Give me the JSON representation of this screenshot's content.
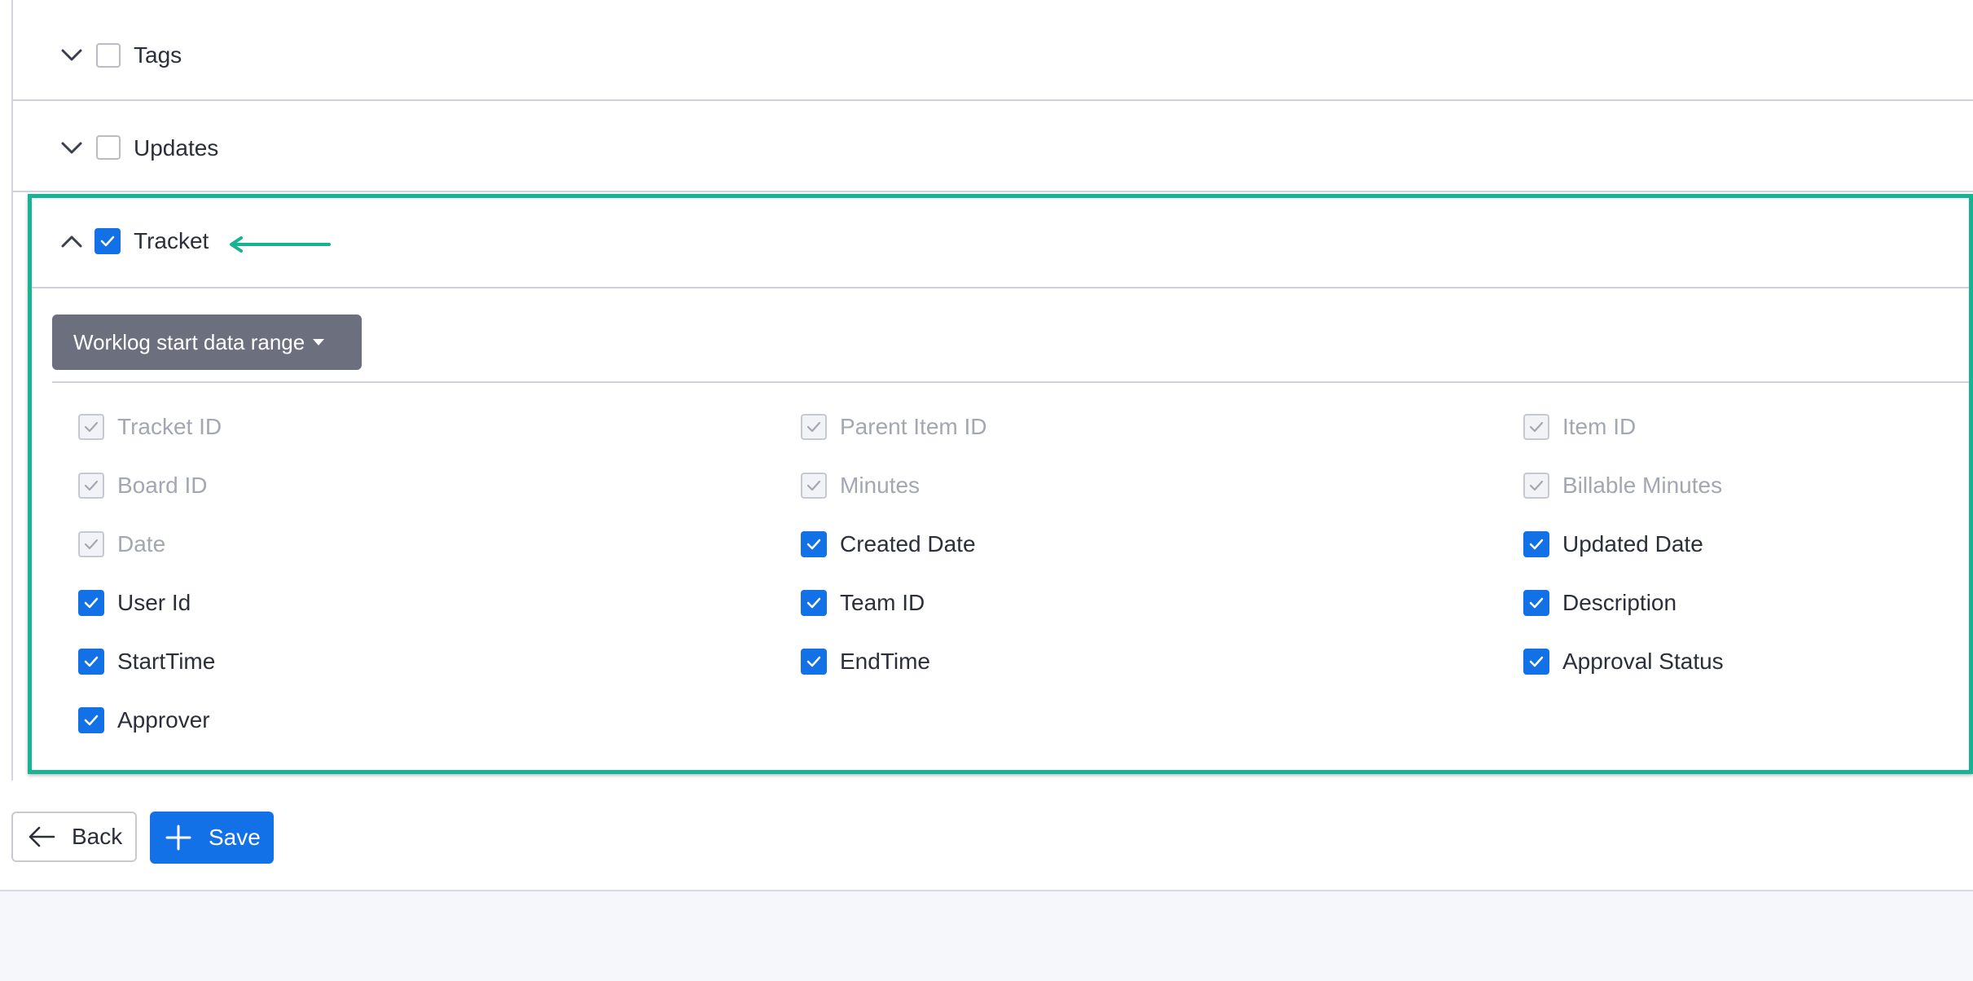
{
  "sections": [
    {
      "label": "Tags",
      "checked": false,
      "expanded": false
    },
    {
      "label": "Updates",
      "checked": false,
      "expanded": false
    },
    {
      "label": "Tracket",
      "checked": true,
      "expanded": true
    }
  ],
  "tracket": {
    "range_button": "Worklog start data range",
    "fields": [
      {
        "label": "Tracket ID",
        "checked": true,
        "disabled": true
      },
      {
        "label": "Parent Item ID",
        "checked": true,
        "disabled": true
      },
      {
        "label": "Item ID",
        "checked": true,
        "disabled": true
      },
      {
        "label": "Board ID",
        "checked": true,
        "disabled": true
      },
      {
        "label": "Minutes",
        "checked": true,
        "disabled": true
      },
      {
        "label": "Billable Minutes",
        "checked": true,
        "disabled": true
      },
      {
        "label": "Date",
        "checked": true,
        "disabled": true
      },
      {
        "label": "Created Date",
        "checked": true,
        "disabled": false
      },
      {
        "label": "Updated Date",
        "checked": true,
        "disabled": false
      },
      {
        "label": "User Id",
        "checked": true,
        "disabled": false
      },
      {
        "label": "Team ID",
        "checked": true,
        "disabled": false
      },
      {
        "label": "Description",
        "checked": true,
        "disabled": false
      },
      {
        "label": "StartTime",
        "checked": true,
        "disabled": false
      },
      {
        "label": "EndTime",
        "checked": true,
        "disabled": false
      },
      {
        "label": "Approval Status",
        "checked": true,
        "disabled": false
      },
      {
        "label": "Approver",
        "checked": true,
        "disabled": false
      }
    ]
  },
  "actions": {
    "back_label": "Back",
    "save_label": "Save"
  },
  "colors": {
    "accent": "#1271e6",
    "highlight": "#17b394",
    "range_button": "#6b6f7e",
    "disabled_text": "#a3a7b2"
  }
}
